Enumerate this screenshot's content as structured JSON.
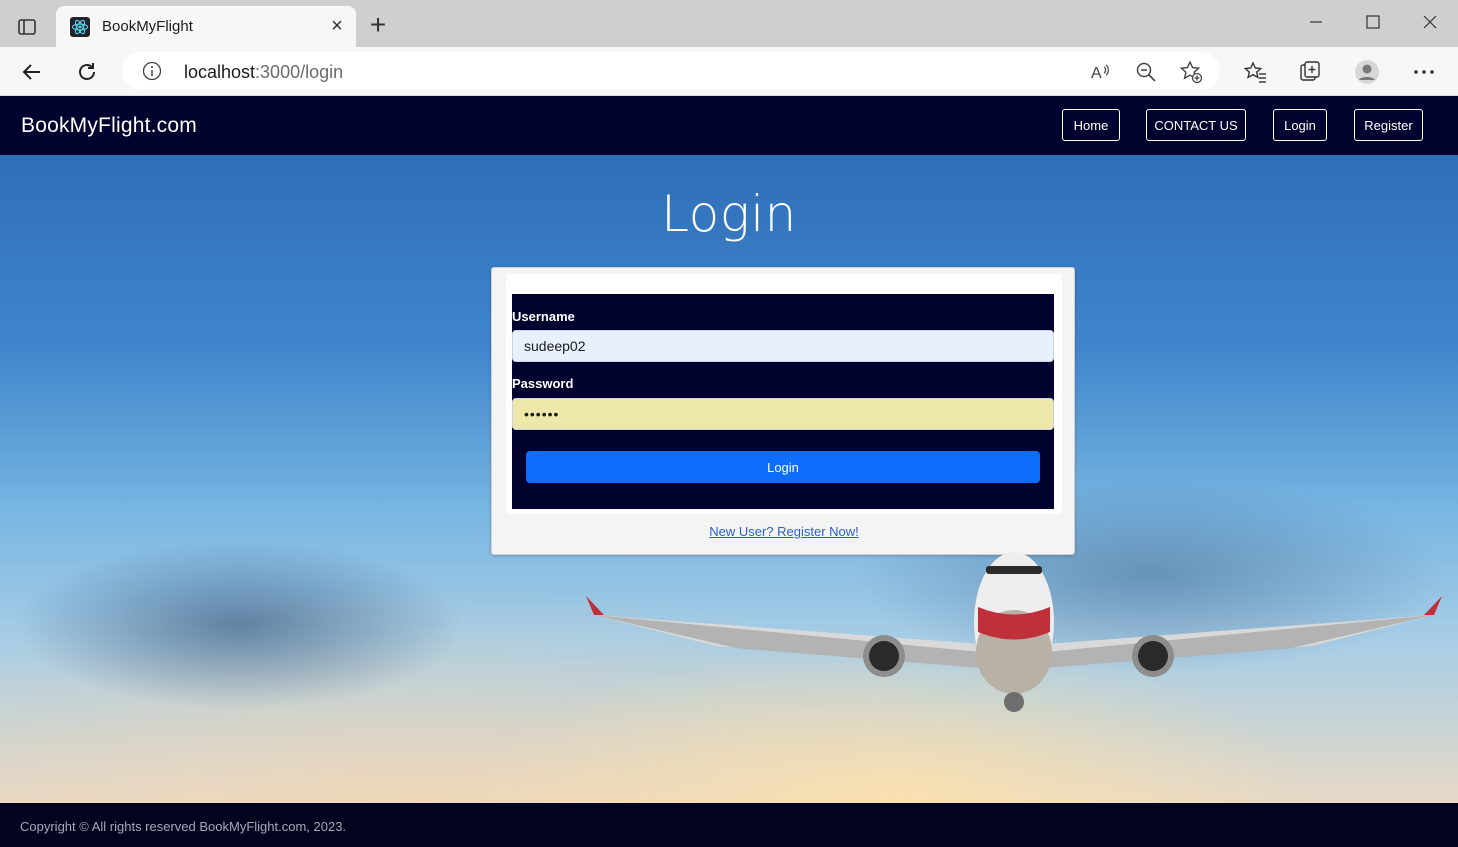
{
  "browser": {
    "tab_title": "BookMyFlight",
    "url_host": "localhost",
    "url_path": ":3000/login",
    "icons": [
      "tab-actions-icon",
      "react-favicon-icon",
      "close-icon",
      "plus-icon",
      "minimize-icon",
      "maximize-icon",
      "window-close-icon",
      "back-icon",
      "refresh-icon",
      "info-icon",
      "read-aloud-icon",
      "zoom-out-icon",
      "add-favorite-icon",
      "favorites-icon",
      "collections-icon",
      "profile-icon",
      "more-icon"
    ]
  },
  "navbar": {
    "brand": "BookMyFlight.com",
    "links": [
      {
        "label": "Home"
      },
      {
        "label": "CONTACT US"
      },
      {
        "label": "Login"
      },
      {
        "label": "Register"
      }
    ]
  },
  "login": {
    "heading": "Login",
    "username_label": "Username",
    "username_value": "sudeep02",
    "password_label": "Password",
    "password_value": "••••••",
    "submit_label": "Login",
    "register_link": "New User? Register Now!"
  },
  "footer": {
    "copyright": "Copyright © All rights reserved BookMyFlight.com, 2023."
  },
  "colors": {
    "navbar_bg": "#01022d",
    "form_bg": "#01022d",
    "submit_bg": "#0d6efd",
    "username_bg": "#e8f0fe",
    "password_bg": "#ede7aa",
    "footer_bg": "#02031f"
  }
}
